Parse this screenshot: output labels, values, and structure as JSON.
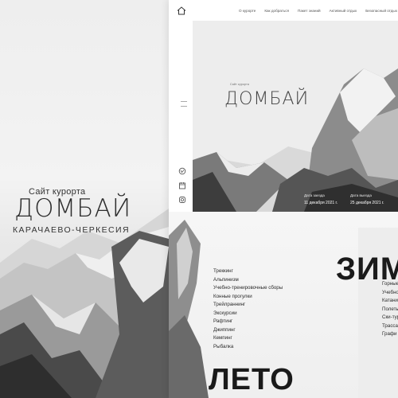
{
  "poster": {
    "site_label": "Сайт курорта",
    "brand": "ДОМБАЙ",
    "region": "КАРАЧАЕВО-ЧЕРКЕСИЯ"
  },
  "nav": {
    "items": [
      "О курорте",
      "Как добраться",
      "Пакет знаний",
      "Активный отдых",
      "Безопасный отдых"
    ]
  },
  "hero": {
    "small_label": "Сайт курорта",
    "brand": "ДОМБАЙ",
    "arrival_label": "Дата заезда",
    "arrival_value": "11 декабря 2021 г.",
    "departure_label": "Дата выезда",
    "departure_value": "25 декабря 2021 г."
  },
  "summer": {
    "title": "ЛЕТО",
    "activities": [
      "Треккинг",
      "Альпинизм",
      "Учебно-тренировочные сборы",
      "Конные прогулки",
      "Трейлраннинг",
      "Экскурсии",
      "Рафтинг",
      "Джиппинг",
      "Кемпинг",
      "Рыбалка"
    ]
  },
  "winter": {
    "title": "ЗИМА",
    "activities": [
      "Горные лыжи",
      "Учебно",
      "Катание",
      "Полеты",
      "Ски-тур",
      "Трасса",
      "Графи"
    ]
  },
  "icons": [
    "home-icon",
    "instagram-icon",
    "vk-icon",
    "calendar-icon"
  ]
}
